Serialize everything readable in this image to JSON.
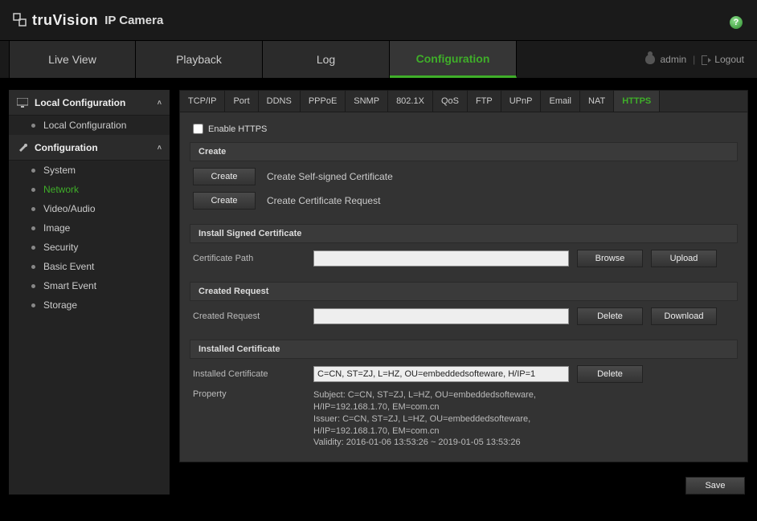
{
  "brand": {
    "name": "truVision",
    "sub": "IP Camera"
  },
  "topnav": {
    "tabs": [
      "Live View",
      "Playback",
      "Log",
      "Configuration"
    ],
    "active_index": 3,
    "user": "admin",
    "logout": "Logout"
  },
  "sidebar": {
    "groups": [
      {
        "title": "Local Configuration",
        "icon": "monitor-icon",
        "items": [
          "Local Configuration"
        ],
        "active_index": -1
      },
      {
        "title": "Configuration",
        "icon": "wrench-icon",
        "items": [
          "System",
          "Network",
          "Video/Audio",
          "Image",
          "Security",
          "Basic Event",
          "Smart Event",
          "Storage"
        ],
        "active_index": 1
      }
    ]
  },
  "subtabs": {
    "items": [
      "TCP/IP",
      "Port",
      "DDNS",
      "PPPoE",
      "SNMP",
      "802.1X",
      "QoS",
      "FTP",
      "UPnP",
      "Email",
      "NAT",
      "HTTPS"
    ],
    "active_index": 11
  },
  "https": {
    "enable_label": "Enable  HTTPS",
    "enable_checked": false,
    "create": {
      "heading": "Create",
      "btn": "Create",
      "line1": "Create Self-signed Certificate",
      "line2": "Create Certificate Request"
    },
    "install": {
      "heading": "Install Signed Certificate",
      "path_label": "Certificate Path",
      "path_value": "",
      "browse": "Browse",
      "upload": "Upload"
    },
    "request": {
      "heading": "Created Request",
      "label": "Created Request",
      "value": "",
      "delete": "Delete",
      "download": "Download"
    },
    "installed": {
      "heading": "Installed Certificate",
      "label": "Installed Certificate",
      "value": "C=CN, ST=ZJ, L=HZ, OU=embeddedsofteware, H/IP=1",
      "delete": "Delete",
      "prop_label": "Property",
      "prop_lines": [
        "Subject: C=CN, ST=ZJ, L=HZ, OU=embeddedsofteware,",
        "H/IP=192.168.1.70, EM=com.cn",
        "Issuer: C=CN, ST=ZJ, L=HZ, OU=embeddedsofteware,",
        "H/IP=192.168.1.70, EM=com.cn",
        "Validity: 2016-01-06 13:53:26 ~ 2019-01-05 13:53:26"
      ]
    },
    "save": "Save"
  }
}
